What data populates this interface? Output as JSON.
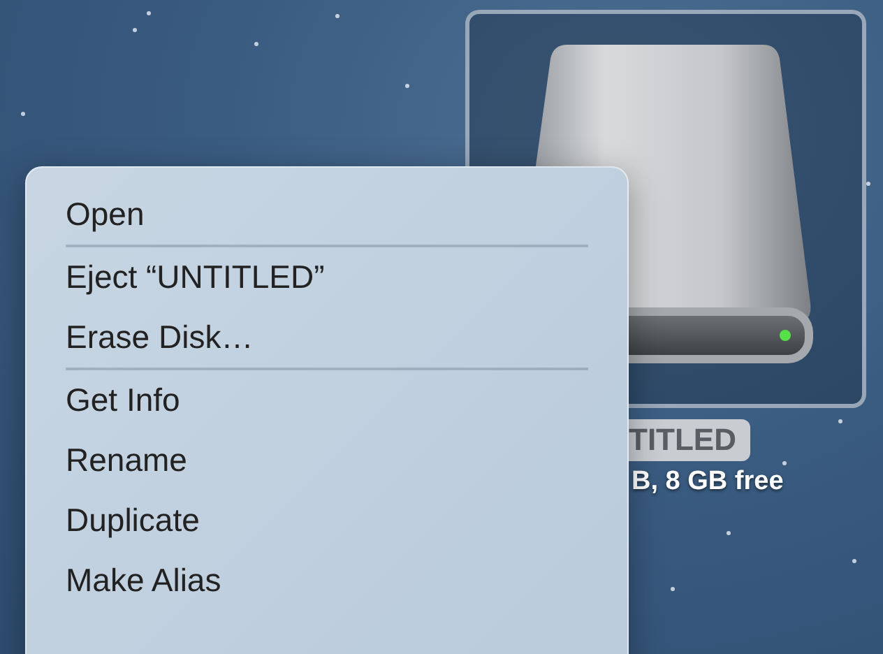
{
  "desktop_icon": {
    "selected": true,
    "label": "TITLED",
    "info": "B, 8 GB free"
  },
  "context_menu": {
    "sections": [
      [
        {
          "label": "Open"
        }
      ],
      [
        {
          "label": "Eject “UNTITLED”"
        },
        {
          "label": "Erase Disk…"
        }
      ],
      [
        {
          "label": "Get Info"
        },
        {
          "label": "Rename"
        },
        {
          "label": "Duplicate"
        },
        {
          "label": "Make Alias"
        }
      ]
    ]
  }
}
